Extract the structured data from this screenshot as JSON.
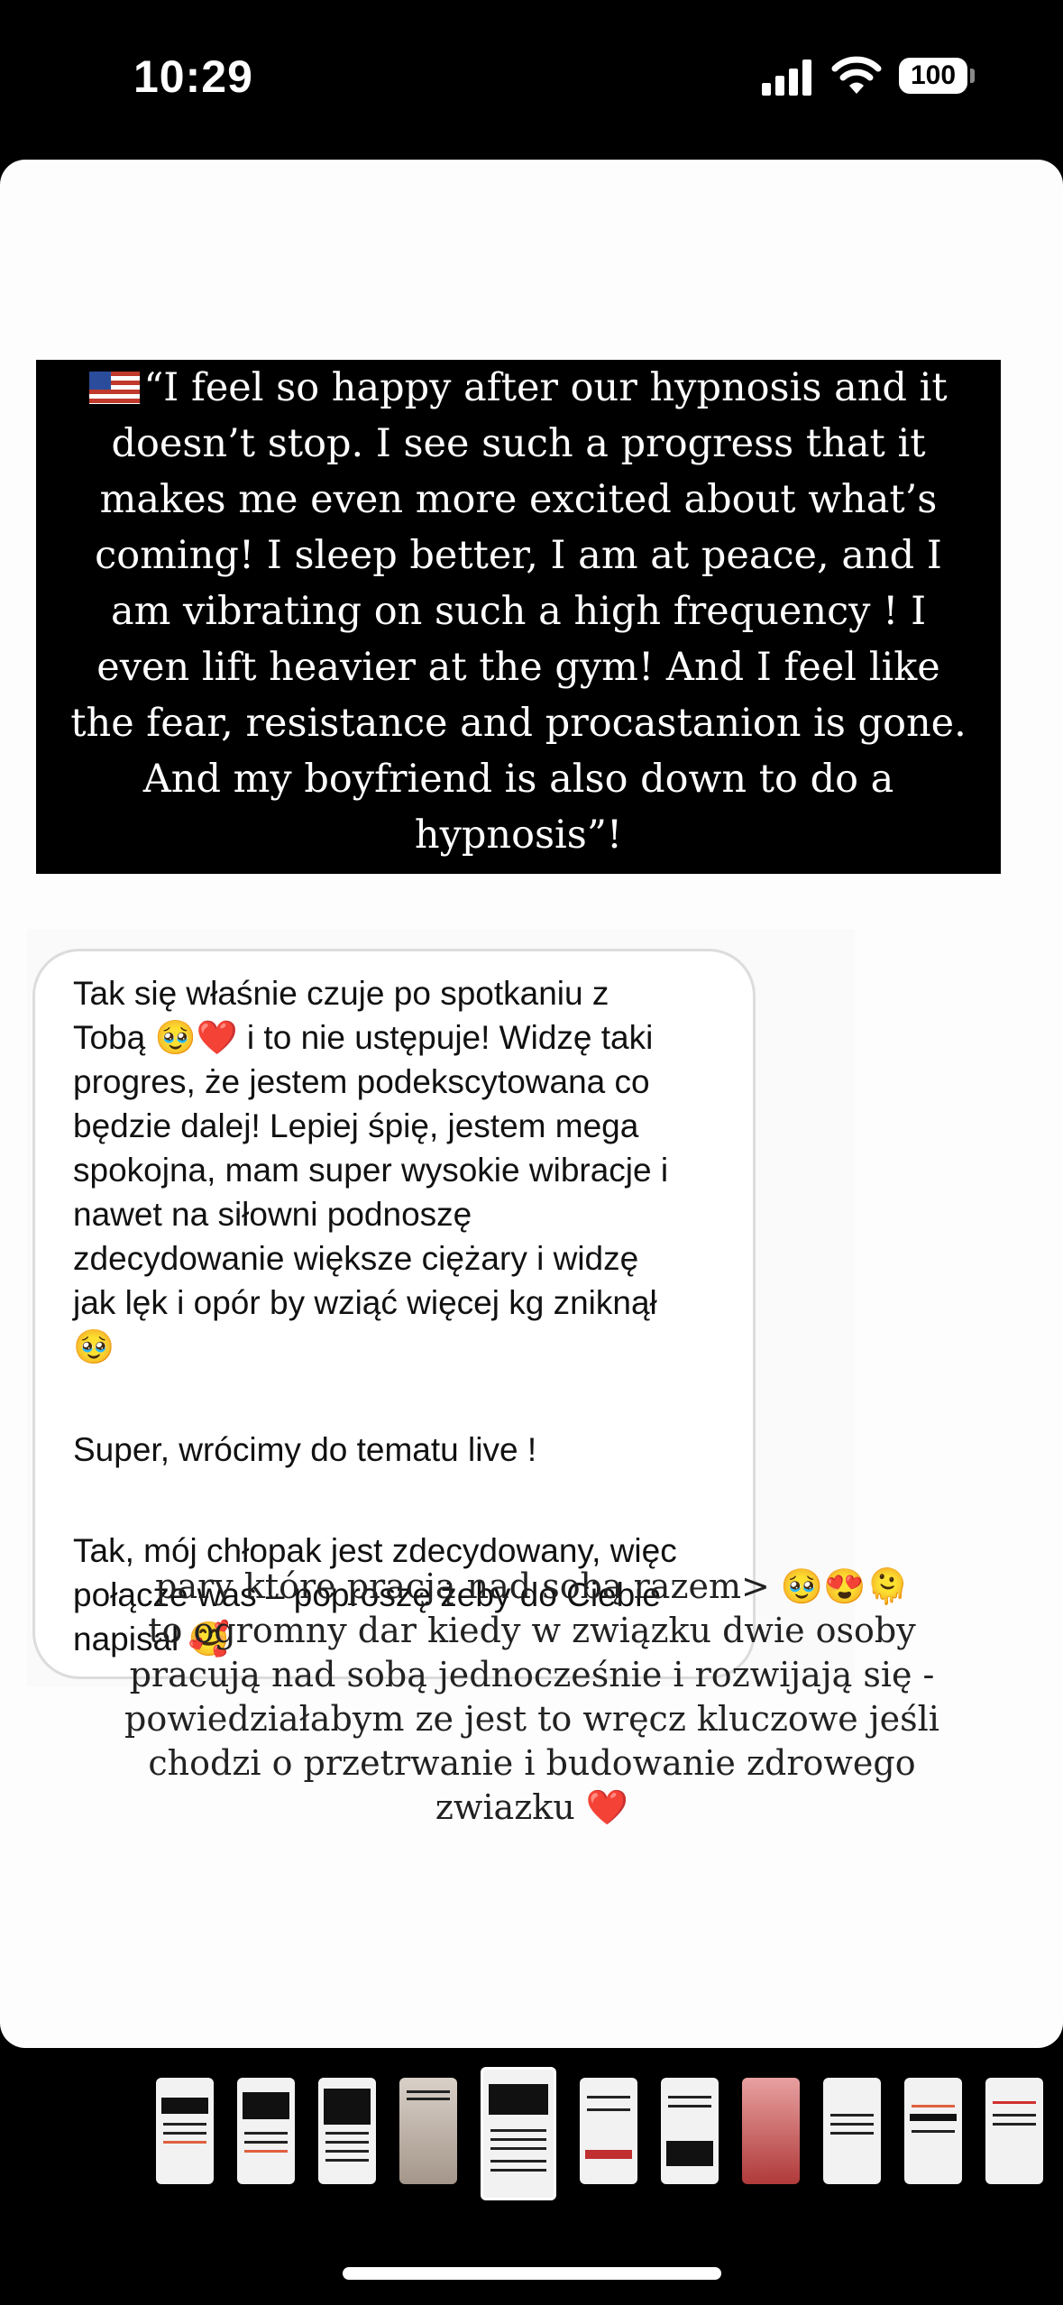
{
  "status_bar": {
    "time": "10:29",
    "battery": "100"
  },
  "story": {
    "quote_block": {
      "flag": "us-flag-icon",
      "lines": [
        "“I feel so happy after our hypnosis and it",
        "doesn’t stop. I see such a progress that it",
        "makes me even more excited about what’s",
        "coming! I sleep better, I am at peace, and I",
        "am vibrating on such a high frequency ! I",
        "even lift heavier at the gym! And I feel like",
        "the fear, resistance and procastanion is gone.",
        "And my boyfriend is also down to do a",
        "hypnosis”!"
      ]
    },
    "message_bubble": {
      "paragraph1_lines": [
        "Tak się właśnie czuje po spotkaniu z",
        "Tobą 🥹❤️ i to nie ustępuje! Widzę taki",
        "progres, że jestem podekscytowana co",
        "będzie dalej! Lepiej śpię, jestem mega",
        "spokojna, mam super wysokie wibracje i",
        "nawet na siłowni podnoszę",
        "zdecydowanie większe ciężary i widzę",
        "jak lęk i opór by wziąć więcej kg zniknął",
        "🥹"
      ],
      "paragraph2": "Super, wrócimy do tematu live !",
      "paragraph3_lines": [
        "Tak, mój chłopak jest zdecydowany, więc",
        "połącze was – poproszę żeby do Ciebie",
        "napisał 🥰"
      ]
    },
    "caption_lines": [
      "pary które pracją nad sobą razem> 🥹😍🫠",
      "to ogromny dar kiedy w związku dwie osoby",
      "pracują nad sobą jednocześnie i rozwijają się -",
      "powiedziałabym ze jest to wręcz kluczowe jeśli",
      "chodzi o przetrwanie i budowanie zdrowego",
      "zwiazku ❤️"
    ]
  },
  "thumbnail_strip": {
    "count": 11,
    "active_index": 4
  },
  "colors": {
    "background": "#000000",
    "card": "#fdfdfd",
    "quote_bg": "#000000",
    "bubble_border": "#dcdcdc"
  }
}
